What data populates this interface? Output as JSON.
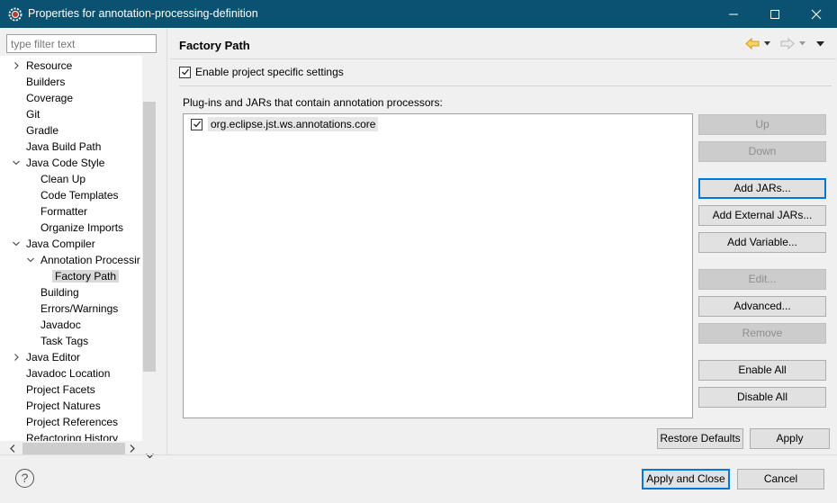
{
  "window": {
    "title": "Properties for annotation-processing-definition",
    "icon": "eclipse-gear-icon",
    "controls": [
      "minimize",
      "maximize",
      "close"
    ]
  },
  "filter": {
    "placeholder": "type filter text",
    "value": ""
  },
  "tree": {
    "items": [
      {
        "label": "Resource",
        "expander": "collapsed",
        "level": 0
      },
      {
        "label": "Builders",
        "expander": "none",
        "level": 0
      },
      {
        "label": "Coverage",
        "expander": "none",
        "level": 0
      },
      {
        "label": "Git",
        "expander": "none",
        "level": 0
      },
      {
        "label": "Gradle",
        "expander": "none",
        "level": 0
      },
      {
        "label": "Java Build Path",
        "expander": "none",
        "level": 0
      },
      {
        "label": "Java Code Style",
        "expander": "expanded",
        "level": 0
      },
      {
        "label": "Clean Up",
        "expander": "none",
        "level": 1
      },
      {
        "label": "Code Templates",
        "expander": "none",
        "level": 1
      },
      {
        "label": "Formatter",
        "expander": "none",
        "level": 1
      },
      {
        "label": "Organize Imports",
        "expander": "none",
        "level": 1
      },
      {
        "label": "Java Compiler",
        "expander": "expanded",
        "level": 0
      },
      {
        "label": "Annotation Processir",
        "expander": "expanded",
        "level": 1
      },
      {
        "label": "Factory Path",
        "expander": "none",
        "level": 2,
        "selected": true
      },
      {
        "label": "Building",
        "expander": "none",
        "level": 1
      },
      {
        "label": "Errors/Warnings",
        "expander": "none",
        "level": 1
      },
      {
        "label": "Javadoc",
        "expander": "none",
        "level": 1
      },
      {
        "label": "Task Tags",
        "expander": "none",
        "level": 1
      },
      {
        "label": "Java Editor",
        "expander": "collapsed",
        "level": 0
      },
      {
        "label": "Javadoc Location",
        "expander": "none",
        "level": 0
      },
      {
        "label": "Project Facets",
        "expander": "none",
        "level": 0
      },
      {
        "label": "Project Natures",
        "expander": "none",
        "level": 0
      },
      {
        "label": "Project References",
        "expander": "none",
        "level": 0
      },
      {
        "label": "Refactoring History",
        "expander": "none",
        "level": 0
      }
    ]
  },
  "page": {
    "title": "Factory Path",
    "enable_label": "Enable project specific settings",
    "enable_checked": true,
    "list_caption": "Plug-ins and JARs that contain annotation processors:",
    "entries": [
      {
        "label": "org.eclipse.jst.ws.annotations.core",
        "checked": true
      }
    ]
  },
  "buttons": {
    "up": "Up",
    "down": "Down",
    "add_jars": "Add JARs...",
    "add_external_jars": "Add External JARs...",
    "add_variable": "Add Variable...",
    "edit": "Edit...",
    "advanced": "Advanced...",
    "remove": "Remove",
    "enable_all": "Enable All",
    "disable_all": "Disable All",
    "restore_defaults": "Restore Defaults",
    "apply": "Apply",
    "apply_and_close": "Apply and Close",
    "cancel": "Cancel"
  },
  "colors": {
    "titlebar": "#0b5272",
    "nav_back_arrow": "#e8a317",
    "focus": "#0078d7"
  }
}
